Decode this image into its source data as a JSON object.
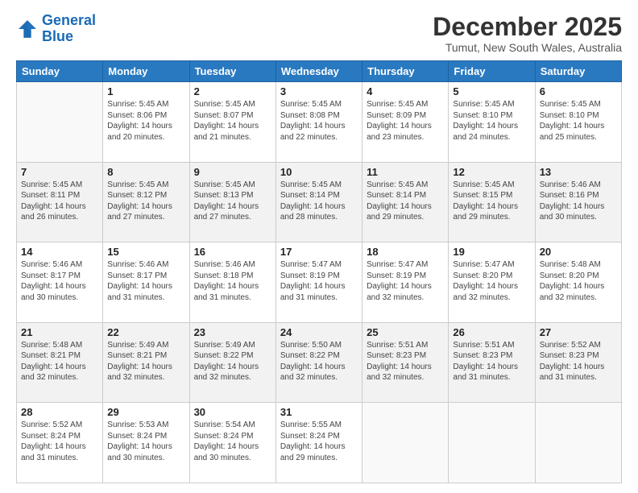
{
  "logo": {
    "line1": "General",
    "line2": "Blue"
  },
  "title": "December 2025",
  "subtitle": "Tumut, New South Wales, Australia",
  "days_header": [
    "Sunday",
    "Monday",
    "Tuesday",
    "Wednesday",
    "Thursday",
    "Friday",
    "Saturday"
  ],
  "weeks": [
    [
      {
        "num": "",
        "sunrise": "",
        "sunset": "",
        "daylight": ""
      },
      {
        "num": "1",
        "sunrise": "Sunrise: 5:45 AM",
        "sunset": "Sunset: 8:06 PM",
        "daylight": "Daylight: 14 hours and 20 minutes."
      },
      {
        "num": "2",
        "sunrise": "Sunrise: 5:45 AM",
        "sunset": "Sunset: 8:07 PM",
        "daylight": "Daylight: 14 hours and 21 minutes."
      },
      {
        "num": "3",
        "sunrise": "Sunrise: 5:45 AM",
        "sunset": "Sunset: 8:08 PM",
        "daylight": "Daylight: 14 hours and 22 minutes."
      },
      {
        "num": "4",
        "sunrise": "Sunrise: 5:45 AM",
        "sunset": "Sunset: 8:09 PM",
        "daylight": "Daylight: 14 hours and 23 minutes."
      },
      {
        "num": "5",
        "sunrise": "Sunrise: 5:45 AM",
        "sunset": "Sunset: 8:10 PM",
        "daylight": "Daylight: 14 hours and 24 minutes."
      },
      {
        "num": "6",
        "sunrise": "Sunrise: 5:45 AM",
        "sunset": "Sunset: 8:10 PM",
        "daylight": "Daylight: 14 hours and 25 minutes."
      }
    ],
    [
      {
        "num": "7",
        "sunrise": "Sunrise: 5:45 AM",
        "sunset": "Sunset: 8:11 PM",
        "daylight": "Daylight: 14 hours and 26 minutes."
      },
      {
        "num": "8",
        "sunrise": "Sunrise: 5:45 AM",
        "sunset": "Sunset: 8:12 PM",
        "daylight": "Daylight: 14 hours and 27 minutes."
      },
      {
        "num": "9",
        "sunrise": "Sunrise: 5:45 AM",
        "sunset": "Sunset: 8:13 PM",
        "daylight": "Daylight: 14 hours and 27 minutes."
      },
      {
        "num": "10",
        "sunrise": "Sunrise: 5:45 AM",
        "sunset": "Sunset: 8:14 PM",
        "daylight": "Daylight: 14 hours and 28 minutes."
      },
      {
        "num": "11",
        "sunrise": "Sunrise: 5:45 AM",
        "sunset": "Sunset: 8:14 PM",
        "daylight": "Daylight: 14 hours and 29 minutes."
      },
      {
        "num": "12",
        "sunrise": "Sunrise: 5:45 AM",
        "sunset": "Sunset: 8:15 PM",
        "daylight": "Daylight: 14 hours and 29 minutes."
      },
      {
        "num": "13",
        "sunrise": "Sunrise: 5:46 AM",
        "sunset": "Sunset: 8:16 PM",
        "daylight": "Daylight: 14 hours and 30 minutes."
      }
    ],
    [
      {
        "num": "14",
        "sunrise": "Sunrise: 5:46 AM",
        "sunset": "Sunset: 8:17 PM",
        "daylight": "Daylight: 14 hours and 30 minutes."
      },
      {
        "num": "15",
        "sunrise": "Sunrise: 5:46 AM",
        "sunset": "Sunset: 8:17 PM",
        "daylight": "Daylight: 14 hours and 31 minutes."
      },
      {
        "num": "16",
        "sunrise": "Sunrise: 5:46 AM",
        "sunset": "Sunset: 8:18 PM",
        "daylight": "Daylight: 14 hours and 31 minutes."
      },
      {
        "num": "17",
        "sunrise": "Sunrise: 5:47 AM",
        "sunset": "Sunset: 8:19 PM",
        "daylight": "Daylight: 14 hours and 31 minutes."
      },
      {
        "num": "18",
        "sunrise": "Sunrise: 5:47 AM",
        "sunset": "Sunset: 8:19 PM",
        "daylight": "Daylight: 14 hours and 32 minutes."
      },
      {
        "num": "19",
        "sunrise": "Sunrise: 5:47 AM",
        "sunset": "Sunset: 8:20 PM",
        "daylight": "Daylight: 14 hours and 32 minutes."
      },
      {
        "num": "20",
        "sunrise": "Sunrise: 5:48 AM",
        "sunset": "Sunset: 8:20 PM",
        "daylight": "Daylight: 14 hours and 32 minutes."
      }
    ],
    [
      {
        "num": "21",
        "sunrise": "Sunrise: 5:48 AM",
        "sunset": "Sunset: 8:21 PM",
        "daylight": "Daylight: 14 hours and 32 minutes."
      },
      {
        "num": "22",
        "sunrise": "Sunrise: 5:49 AM",
        "sunset": "Sunset: 8:21 PM",
        "daylight": "Daylight: 14 hours and 32 minutes."
      },
      {
        "num": "23",
        "sunrise": "Sunrise: 5:49 AM",
        "sunset": "Sunset: 8:22 PM",
        "daylight": "Daylight: 14 hours and 32 minutes."
      },
      {
        "num": "24",
        "sunrise": "Sunrise: 5:50 AM",
        "sunset": "Sunset: 8:22 PM",
        "daylight": "Daylight: 14 hours and 32 minutes."
      },
      {
        "num": "25",
        "sunrise": "Sunrise: 5:51 AM",
        "sunset": "Sunset: 8:23 PM",
        "daylight": "Daylight: 14 hours and 32 minutes."
      },
      {
        "num": "26",
        "sunrise": "Sunrise: 5:51 AM",
        "sunset": "Sunset: 8:23 PM",
        "daylight": "Daylight: 14 hours and 31 minutes."
      },
      {
        "num": "27",
        "sunrise": "Sunrise: 5:52 AM",
        "sunset": "Sunset: 8:23 PM",
        "daylight": "Daylight: 14 hours and 31 minutes."
      }
    ],
    [
      {
        "num": "28",
        "sunrise": "Sunrise: 5:52 AM",
        "sunset": "Sunset: 8:24 PM",
        "daylight": "Daylight: 14 hours and 31 minutes."
      },
      {
        "num": "29",
        "sunrise": "Sunrise: 5:53 AM",
        "sunset": "Sunset: 8:24 PM",
        "daylight": "Daylight: 14 hours and 30 minutes."
      },
      {
        "num": "30",
        "sunrise": "Sunrise: 5:54 AM",
        "sunset": "Sunset: 8:24 PM",
        "daylight": "Daylight: 14 hours and 30 minutes."
      },
      {
        "num": "31",
        "sunrise": "Sunrise: 5:55 AM",
        "sunset": "Sunset: 8:24 PM",
        "daylight": "Daylight: 14 hours and 29 minutes."
      },
      {
        "num": "",
        "sunrise": "",
        "sunset": "",
        "daylight": ""
      },
      {
        "num": "",
        "sunrise": "",
        "sunset": "",
        "daylight": ""
      },
      {
        "num": "",
        "sunrise": "",
        "sunset": "",
        "daylight": ""
      }
    ]
  ]
}
